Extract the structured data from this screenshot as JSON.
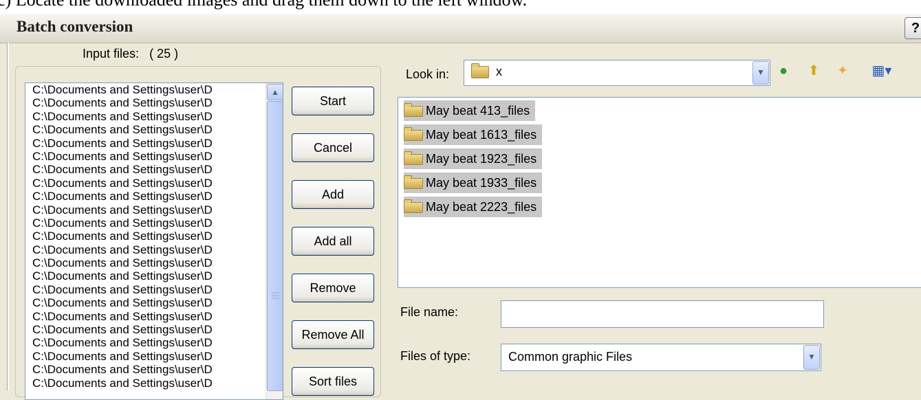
{
  "top_caption": "c) Locate the downloaded images and drag them down to the left window.",
  "window": {
    "title": "Batch conversion",
    "help_label": "?"
  },
  "input": {
    "label": "Input files:",
    "count": "( 25 )"
  },
  "file_list": [
    "C:\\Documents and Settings\\user\\D",
    "C:\\Documents and Settings\\user\\D",
    "C:\\Documents and Settings\\user\\D",
    "C:\\Documents and Settings\\user\\D",
    "C:\\Documents and Settings\\user\\D",
    "C:\\Documents and Settings\\user\\D",
    "C:\\Documents and Settings\\user\\D",
    "C:\\Documents and Settings\\user\\D",
    "C:\\Documents and Settings\\user\\D",
    "C:\\Documents and Settings\\user\\D",
    "C:\\Documents and Settings\\user\\D",
    "C:\\Documents and Settings\\user\\D",
    "C:\\Documents and Settings\\user\\D",
    "C:\\Documents and Settings\\user\\D",
    "C:\\Documents and Settings\\user\\D",
    "C:\\Documents and Settings\\user\\D",
    "C:\\Documents and Settings\\user\\D",
    "C:\\Documents and Settings\\user\\D",
    "C:\\Documents and Settings\\user\\D",
    "C:\\Documents and Settings\\user\\D",
    "C:\\Documents and Settings\\user\\D",
    "C:\\Documents and Settings\\user\\D",
    "C:\\Documents and Settings\\user\\D"
  ],
  "buttons": {
    "start": "Start",
    "cancel": "Cancel",
    "add": "Add",
    "add_all": "Add all",
    "remove": "Remove",
    "remove_all": "Remove All",
    "sort_files": "Sort files"
  },
  "browser": {
    "look_in_label": "Look in:",
    "look_in_value": "x",
    "folders": [
      "May beat 413_files",
      "May beat 1613_files",
      "May beat 1923_files",
      "May beat 1933_files",
      "May beat 2223_files"
    ],
    "file_name_label": "File name:",
    "file_name_value": "",
    "file_type_label": "Files of type:",
    "file_type_value": "Common graphic Files"
  },
  "icons": {
    "back": "back-arrow-icon",
    "up": "up-folder-icon",
    "new_folder": "new-folder-icon",
    "view_menu": "view-menu-icon"
  },
  "colors": {
    "selection": "#c8c8c8",
    "face": "#ece9d8",
    "border_blue": "#7f9db9"
  }
}
